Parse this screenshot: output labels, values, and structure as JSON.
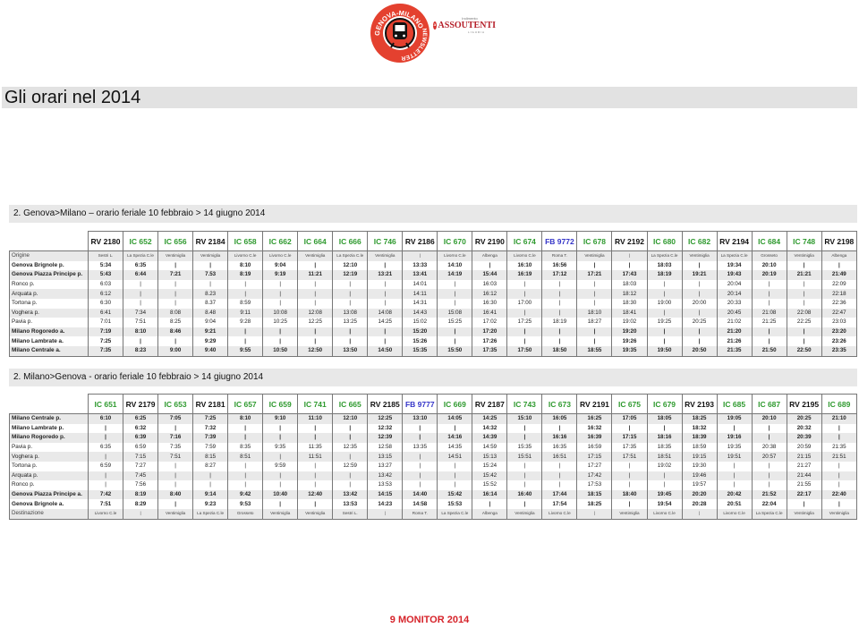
{
  "logo": {
    "text": "GENOVA-MILANO NEWSLETTER",
    "icon": "train-icon",
    "color": "#e4412f"
  },
  "partner": {
    "small": "Indimento",
    "name": "ASSOUTENTI",
    "sub": "LIGURIA",
    "color": "#b5202a"
  },
  "title": "Gli orari nel 2014",
  "colors": {
    "IC": "#2f9a2f",
    "FB": "#3535c8",
    "RV": "#111111",
    "footer": "#d6232a"
  },
  "tables": [
    {
      "heading": "2. Genova>Milano  – orario feriale 10 febbraio > 14 giugno 2014",
      "trains": [
        "RV 2180",
        "IC 652",
        "IC 656",
        "RV 2184",
        "IC 658",
        "IC 662",
        "IC 664",
        "IC 666",
        "IC 746",
        "RV 2186",
        "IC 670",
        "RV 2190",
        "IC 674",
        "FB 9772",
        "IC 678",
        "RV 2192",
        "IC 680",
        "IC 682",
        "RV 2194",
        "IC 684",
        "IC 748",
        "RV 2198"
      ],
      "rows": [
        {
          "station": "Origine",
          "bold": false,
          "small": true,
          "times": [
            "Sestri L.",
            "La Spezia C.le",
            "Ventimiglia",
            "Ventimiglia",
            "Livorno C.le",
            "Livorno C.le",
            "Ventimiglia",
            "La Spezia C.le",
            "Ventimiglia",
            "|",
            "Livorno C.le",
            "Albenga",
            "Livorno C.le",
            "Roma T.",
            "Ventimiglia",
            "|",
            "La Spezia C.le",
            "Ventimiglia",
            "La Spezia C.le",
            "Grosseto",
            "Ventimiglia",
            "Albenga"
          ]
        },
        {
          "station": "Genova Brignole p.",
          "bold": true,
          "times": [
            "5:34",
            "6:35",
            "|",
            "|",
            "8:10",
            "9:04",
            "|",
            "12:10",
            "|",
            "13:33",
            "14:10",
            "|",
            "16:10",
            "16:56",
            "|",
            "|",
            "18:03",
            "|",
            "19:34",
            "20:10",
            "|",
            "|"
          ]
        },
        {
          "station": "Genova Piazza Principe p.",
          "bold": true,
          "times": [
            "5:43",
            "6:44",
            "7:21",
            "7.53",
            "8:19",
            "9:19",
            "11:21",
            "12:19",
            "13:21",
            "13:41",
            "14:19",
            "15:44",
            "16:19",
            "17:12",
            "17:21",
            "17:43",
            "18:19",
            "19:21",
            "19:43",
            "20:19",
            "21:21",
            "21:49"
          ]
        },
        {
          "station": "Ronco p.",
          "bold": false,
          "times": [
            "6:03",
            "|",
            "|",
            "|",
            "|",
            "|",
            "|",
            "|",
            "|",
            "14:01",
            "|",
            "16:03",
            "|",
            "|",
            "|",
            "18:03",
            "|",
            "|",
            "20:04",
            "|",
            "|",
            "22:09"
          ]
        },
        {
          "station": "Arquata p.",
          "bold": false,
          "times": [
            "6:12",
            "|",
            "|",
            "8.23",
            "|",
            "|",
            "|",
            "|",
            "|",
            "14:11",
            "|",
            "16:12",
            "|",
            "|",
            "|",
            "18:12",
            "|",
            "|",
            "20:14",
            "|",
            "|",
            "22:18"
          ]
        },
        {
          "station": "Tortona p.",
          "bold": false,
          "times": [
            "6:30",
            "|",
            "|",
            "8.37",
            "8:59",
            "|",
            "|",
            "|",
            "|",
            "14:31",
            "|",
            "16:30",
            "17:00",
            "|",
            "|",
            "18:30",
            "19:00",
            "20:00",
            "20:33",
            "|",
            "|",
            "22:36"
          ]
        },
        {
          "station": "Voghera p.",
          "bold": false,
          "times": [
            "6:41",
            "7:34",
            "8:08",
            "8.48",
            "9:11",
            "10:08",
            "12:08",
            "13:08",
            "14:08",
            "14:43",
            "15:08",
            "16:41",
            "|",
            "|",
            "18:10",
            "18:41",
            "|",
            "|",
            "20:45",
            "21:08",
            "22:08",
            "22:47"
          ]
        },
        {
          "station": "Pavia p.",
          "bold": false,
          "times": [
            "7:01",
            "7:51",
            "8:25",
            "9:04",
            "9:28",
            "10:25",
            "12:25",
            "13:25",
            "14:25",
            "15:02",
            "15:25",
            "17:02",
            "17:25",
            "18:19",
            "18:27",
            "19:02",
            "19:25",
            "20:25",
            "21:02",
            "21:25",
            "22:25",
            "23:03"
          ]
        },
        {
          "station": "Milano Rogoredo a.",
          "bold": true,
          "times": [
            "7:19",
            "8:10",
            "8:46",
            "9:21",
            "|",
            "|",
            "|",
            "|",
            "|",
            "15:20",
            "|",
            "17:20",
            "|",
            "|",
            "|",
            "19:20",
            "|",
            "|",
            "21:20",
            "|",
            "|",
            "23:20"
          ]
        },
        {
          "station": "Milano Lambrate a.",
          "bold": true,
          "times": [
            "7:25",
            "|",
            "|",
            "9:29",
            "|",
            "|",
            "|",
            "|",
            "|",
            "15:26",
            "|",
            "17:26",
            "|",
            "|",
            "|",
            "19:26",
            "|",
            "|",
            "21:26",
            "|",
            "|",
            "23:26"
          ]
        },
        {
          "station": "Milano Centrale a.",
          "bold": true,
          "times": [
            "7:35",
            "8:23",
            "9:00",
            "9:40",
            "9:55",
            "10:50",
            "12:50",
            "13:50",
            "14:50",
            "15:35",
            "15:50",
            "17:35",
            "17:50",
            "18:50",
            "18:55",
            "19:35",
            "19:50",
            "20:50",
            "21:35",
            "21:50",
            "22:50",
            "23:35"
          ]
        }
      ]
    },
    {
      "heading": "2. Milano>Genova - orario feriale 10 febbraio > 14 giugno 2014",
      "trains": [
        "IC 651",
        "RV 2179",
        "IC 653",
        "RV 2181",
        "IC 657",
        "IC 659",
        "IC 741",
        "IC 665",
        "RV 2185",
        "FB 9777",
        "IC 669",
        "RV 2187",
        "IC 743",
        "IC 673",
        "RV 2191",
        "IC 675",
        "IC 679",
        "RV 2193",
        "IC 685",
        "IC 687",
        "RV 2195",
        "IC 689"
      ],
      "rows": [
        {
          "station": "Milano Centrale p.",
          "bold": true,
          "times": [
            "6:10",
            "6:25",
            "7:05",
            "7:25",
            "8:10",
            "9:10",
            "11:10",
            "12:10",
            "12:25",
            "13:10",
            "14:05",
            "14:25",
            "15:10",
            "16:05",
            "16:25",
            "17:05",
            "18:05",
            "18:25",
            "19:05",
            "20:10",
            "20:25",
            "21:10"
          ]
        },
        {
          "station": "Milano Lambrate p.",
          "bold": true,
          "times": [
            "|",
            "6:32",
            "|",
            "7:32",
            "|",
            "|",
            "|",
            "|",
            "12:32",
            "|",
            "|",
            "14:32",
            "|",
            "|",
            "16:32",
            "|",
            "|",
            "18:32",
            "|",
            "|",
            "20:32",
            "|"
          ]
        },
        {
          "station": "Milano Rogoredo p.",
          "bold": true,
          "times": [
            "|",
            "6:39",
            "7:16",
            "7:39",
            "|",
            "|",
            "|",
            "|",
            "12:39",
            "|",
            "14:16",
            "14:39",
            "|",
            "16:16",
            "16:39",
            "17:15",
            "18:16",
            "18:39",
            "19:16",
            "|",
            "20:39",
            "|"
          ]
        },
        {
          "station": "Pavia p.",
          "bold": false,
          "times": [
            "6:35",
            "6:59",
            "7:35",
            "7:59",
            "8:35",
            "9:35",
            "11:35",
            "12:35",
            "12:58",
            "13:35",
            "14:35",
            "14:59",
            "15:35",
            "16:35",
            "16:59",
            "17:35",
            "18:35",
            "18:59",
            "19:35",
            "20:38",
            "20:59",
            "21:35"
          ]
        },
        {
          "station": "Voghera p.",
          "bold": false,
          "times": [
            "|",
            "7:15",
            "7:51",
            "8:15",
            "8:51",
            "|",
            "11:51",
            "|",
            "13:15",
            "|",
            "14:51",
            "15:13",
            "15:51",
            "16:51",
            "17:15",
            "17:51",
            "18:51",
            "19:15",
            "19:51",
            "20:57",
            "21:15",
            "21:51"
          ]
        },
        {
          "station": "Tortona p.",
          "bold": false,
          "times": [
            "6:59",
            "7:27",
            "|",
            "8:27",
            "|",
            "9:59",
            "|",
            "12:59",
            "13:27",
            "|",
            "|",
            "15:24",
            "|",
            "|",
            "17:27",
            "|",
            "19:02",
            "19:30",
            "|",
            "|",
            "21:27",
            "|"
          ]
        },
        {
          "station": "Arquata p.",
          "bold": false,
          "times": [
            "|",
            "7:45",
            "|",
            "|",
            "|",
            "|",
            "|",
            "|",
            "13:42",
            "|",
            "|",
            "15:42",
            "|",
            "|",
            "17:42",
            "|",
            "|",
            "19:46",
            "|",
            "|",
            "21:44",
            "|"
          ]
        },
        {
          "station": "Ronco p.",
          "bold": false,
          "times": [
            "|",
            "7:56",
            "|",
            "|",
            "|",
            "|",
            "|",
            "|",
            "13:53",
            "|",
            "|",
            "15:52",
            "|",
            "|",
            "17:53",
            "|",
            "|",
            "19:57",
            "|",
            "|",
            "21:55",
            "|"
          ]
        },
        {
          "station": "Genova Piazza Principe a.",
          "bold": true,
          "times": [
            "7:42",
            "8:19",
            "8:40",
            "9:14",
            "9:42",
            "10:40",
            "12:40",
            "13:42",
            "14:15",
            "14:40",
            "15:42",
            "16:14",
            "16:40",
            "17:44",
            "18:15",
            "18:40",
            "19:45",
            "20:20",
            "20:42",
            "21:52",
            "22:17",
            "22:40"
          ]
        },
        {
          "station": "Genova Brignole a.",
          "bold": true,
          "times": [
            "7:51",
            "8:29",
            "|",
            "9:23",
            "9:53",
            "|",
            "|",
            "13:53",
            "14:23",
            "14:58",
            "15:53",
            "|",
            "|",
            "17:54",
            "18:25",
            "|",
            "19:54",
            "20:28",
            "20:51",
            "22:04",
            "|",
            "|"
          ]
        },
        {
          "station": "Destinazione",
          "bold": false,
          "small": true,
          "times": [
            "Livorno C.le",
            "|",
            "Ventimiglia",
            "La Spezia C.le",
            "Grosseto",
            "Ventimiglia",
            "Ventimiglia",
            "Sestri L.",
            "|",
            "Roma T.",
            "La Spezia C.le",
            "Albenga",
            "Ventimiglia",
            "Livorno C.le",
            "|",
            "Ventimiglia",
            "Livorno C.le",
            "|",
            "Livorno C.le",
            "La Spezia C.le",
            "Ventimiglia",
            "Ventimiglia"
          ]
        }
      ]
    }
  ],
  "footer": "9 MONITOR 2014"
}
